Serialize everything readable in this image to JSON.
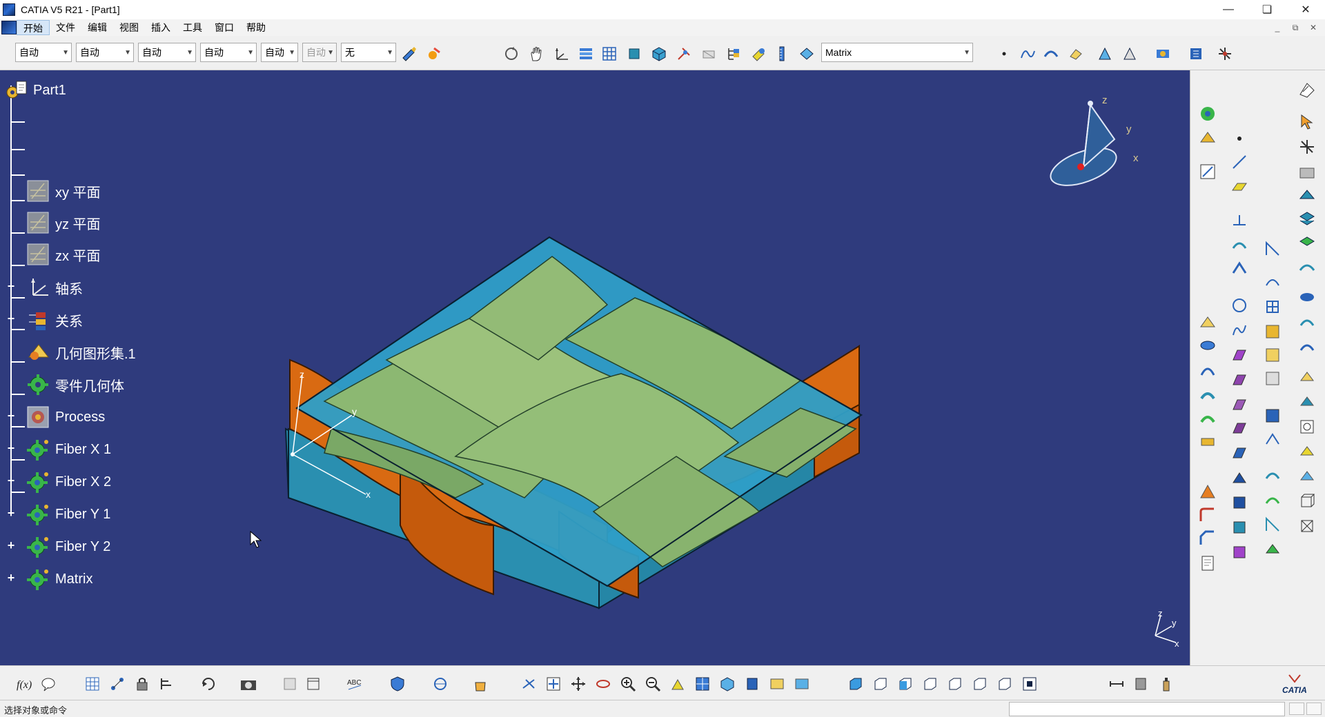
{
  "window": {
    "title": "CATIA V5 R21 - [Part1]"
  },
  "menu": {
    "items": [
      "开始",
      "文件",
      "编辑",
      "视图",
      "插入",
      "工具",
      "窗口",
      "帮助"
    ]
  },
  "toolbar": {
    "combos": [
      "自动",
      "自动",
      "自动",
      "自动",
      "自动",
      "自动",
      "无"
    ],
    "body_select": "Matrix"
  },
  "tree": {
    "root": "Part1",
    "items": [
      {
        "label": "xy 平面",
        "icon": "plane-icon"
      },
      {
        "label": "yz 平面",
        "icon": "plane-icon"
      },
      {
        "label": "zx 平面",
        "icon": "plane-icon"
      },
      {
        "label": "轴系",
        "icon": "axis-system-icon"
      },
      {
        "label": "关系",
        "icon": "relations-icon"
      },
      {
        "label": "几何图形集.1",
        "icon": "geometrical-set-icon"
      },
      {
        "label": "零件几何体",
        "icon": "part-body-icon"
      },
      {
        "label": "Process",
        "icon": "process-icon"
      },
      {
        "label": "Fiber X 1",
        "icon": "body-icon"
      },
      {
        "label": "Fiber X 2",
        "icon": "body-icon"
      },
      {
        "label": "Fiber Y 1",
        "icon": "body-icon"
      },
      {
        "label": "Fiber Y 2",
        "icon": "body-icon"
      },
      {
        "label": "Matrix",
        "icon": "body-icon"
      }
    ]
  },
  "viewport": {
    "background": "#2f3b7d",
    "axis_labels": {
      "x": "x",
      "y": "y",
      "z": "z"
    },
    "compass": {
      "x": "x",
      "y": "y",
      "z": "z"
    },
    "mini_axis": {
      "x": "x",
      "y": "y",
      "z": "z"
    },
    "colors": {
      "matrix": "#2a8fb0",
      "fiber_green": "#86b06e",
      "fiber_orange": "#d96a12"
    }
  },
  "status": {
    "text": "选择对象或命令"
  },
  "brand": {
    "logo_text": "CATIA"
  }
}
